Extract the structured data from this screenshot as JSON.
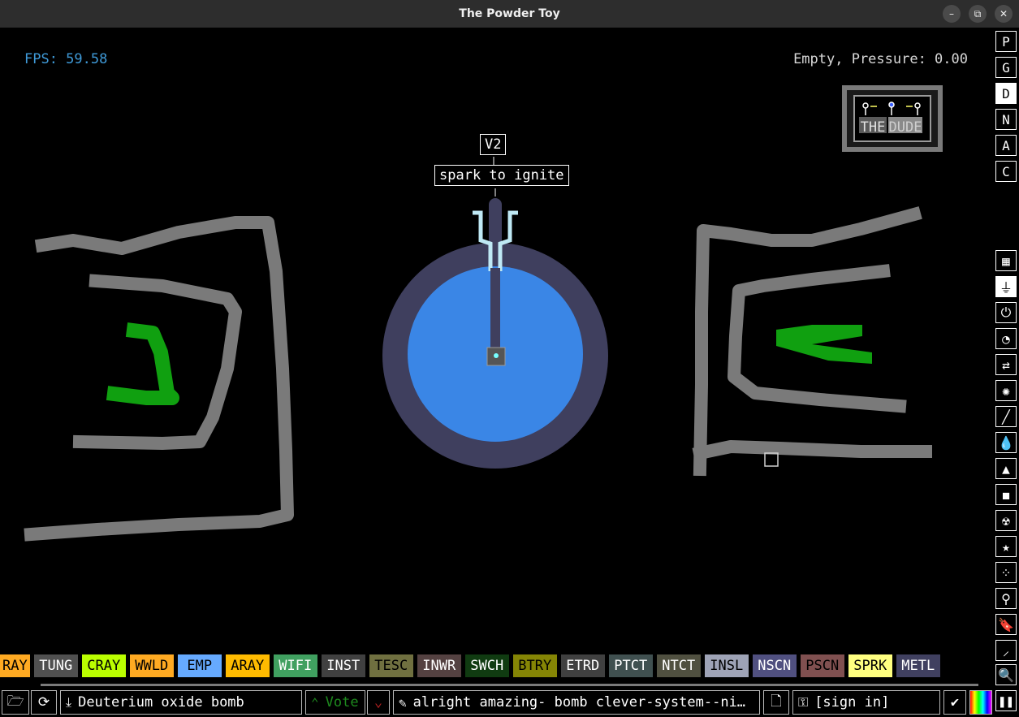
{
  "window": {
    "title": "The Powder Toy",
    "minimize": "–",
    "restore": "⧉",
    "close": "✕"
  },
  "hud": {
    "fps": "FPS: 59.58",
    "status": "Empty, Pressure: 0.00"
  },
  "signs": {
    "version": "V2",
    "hint": "spark to ignite"
  },
  "logo": {
    "word1": "THE",
    "word2": "DUDE"
  },
  "right_menu": {
    "letters": [
      "P",
      "G",
      "D",
      "N",
      "A",
      "C"
    ],
    "active_letter": "D",
    "categories": [
      {
        "name": "walls-icon",
        "glyph": "▦"
      },
      {
        "name": "electronics-icon",
        "glyph": "⏚"
      },
      {
        "name": "powered-icon",
        "glyph": "⏻"
      },
      {
        "name": "sensors-icon",
        "glyph": "◔"
      },
      {
        "name": "force-icon",
        "glyph": "⇄"
      },
      {
        "name": "explosives-icon",
        "glyph": "✺"
      },
      {
        "name": "gases-icon",
        "glyph": "╱"
      },
      {
        "name": "liquids-icon",
        "glyph": "💧"
      },
      {
        "name": "powders-icon",
        "glyph": "▲"
      },
      {
        "name": "solids-icon",
        "glyph": "◼"
      },
      {
        "name": "radioactive-icon",
        "glyph": "☢"
      },
      {
        "name": "special-icon",
        "glyph": "★"
      },
      {
        "name": "life-icon",
        "glyph": "⁘"
      },
      {
        "name": "tools-icon",
        "glyph": "⚲"
      },
      {
        "name": "favorites-icon",
        "glyph": "🔖"
      },
      {
        "name": "decoration-icon",
        "glyph": "⸝"
      },
      {
        "name": "search-icon",
        "glyph": "🔍"
      }
    ],
    "pause": "❚❚"
  },
  "elements": [
    {
      "label": "RAY",
      "bg": "#ffaa22",
      "fg": "#000000"
    },
    {
      "label": "TUNG",
      "bg": "#505050",
      "fg": "#ffffff"
    },
    {
      "label": "CRAY",
      "bg": "#bbff00",
      "fg": "#000000"
    },
    {
      "label": "WWLD",
      "bg": "#ffaa22",
      "fg": "#000000"
    },
    {
      "label": "EMP",
      "bg": "#66aaff",
      "fg": "#000000"
    },
    {
      "label": "ARAY",
      "bg": "#ffbb00",
      "fg": "#000000"
    },
    {
      "label": "WIFI",
      "bg": "#40a060",
      "fg": "#ffffff"
    },
    {
      "label": "INST",
      "bg": "#404040",
      "fg": "#ffffff"
    },
    {
      "label": "TESC",
      "bg": "#707040",
      "fg": "#000000"
    },
    {
      "label": "INWR",
      "bg": "#544141",
      "fg": "#ffffff"
    },
    {
      "label": "SWCH",
      "bg": "#103b11",
      "fg": "#ffffff"
    },
    {
      "label": "BTRY",
      "bg": "#858505",
      "fg": "#000000"
    },
    {
      "label": "ETRD",
      "bg": "#404040",
      "fg": "#ffffff"
    },
    {
      "label": "PTCT",
      "bg": "#405050",
      "fg": "#ffffff"
    },
    {
      "label": "NTCT",
      "bg": "#505040",
      "fg": "#ffffff"
    },
    {
      "label": "INSL",
      "bg": "#9ea3b6",
      "fg": "#000000"
    },
    {
      "label": "NSCN",
      "bg": "#505080",
      "fg": "#ffffff"
    },
    {
      "label": "PSCN",
      "bg": "#805050",
      "fg": "#000000"
    },
    {
      "label": "SPRK",
      "bg": "#ffff80",
      "fg": "#000000"
    },
    {
      "label": "METL",
      "bg": "#404060",
      "fg": "#ffffff"
    }
  ],
  "bottom": {
    "open": "🗁",
    "reload": "⟳",
    "save_name": "Deuterium oxide bomb",
    "vote_up": "Vote",
    "vote_down": "⌄",
    "tags": "alright amazing- bomb clever-system--ni…",
    "tags_icon": "✎",
    "new_icon": "🗋",
    "login": "[sign in]",
    "login_icon": "⚿",
    "settings": "✔"
  },
  "colors": {
    "wall": "#7a7a7a",
    "plant": "#10a010",
    "shell": "#3f3f5e",
    "water": "#3a86e6",
    "glass": "#bfe9f5",
    "fps": "#3f9ad8"
  }
}
